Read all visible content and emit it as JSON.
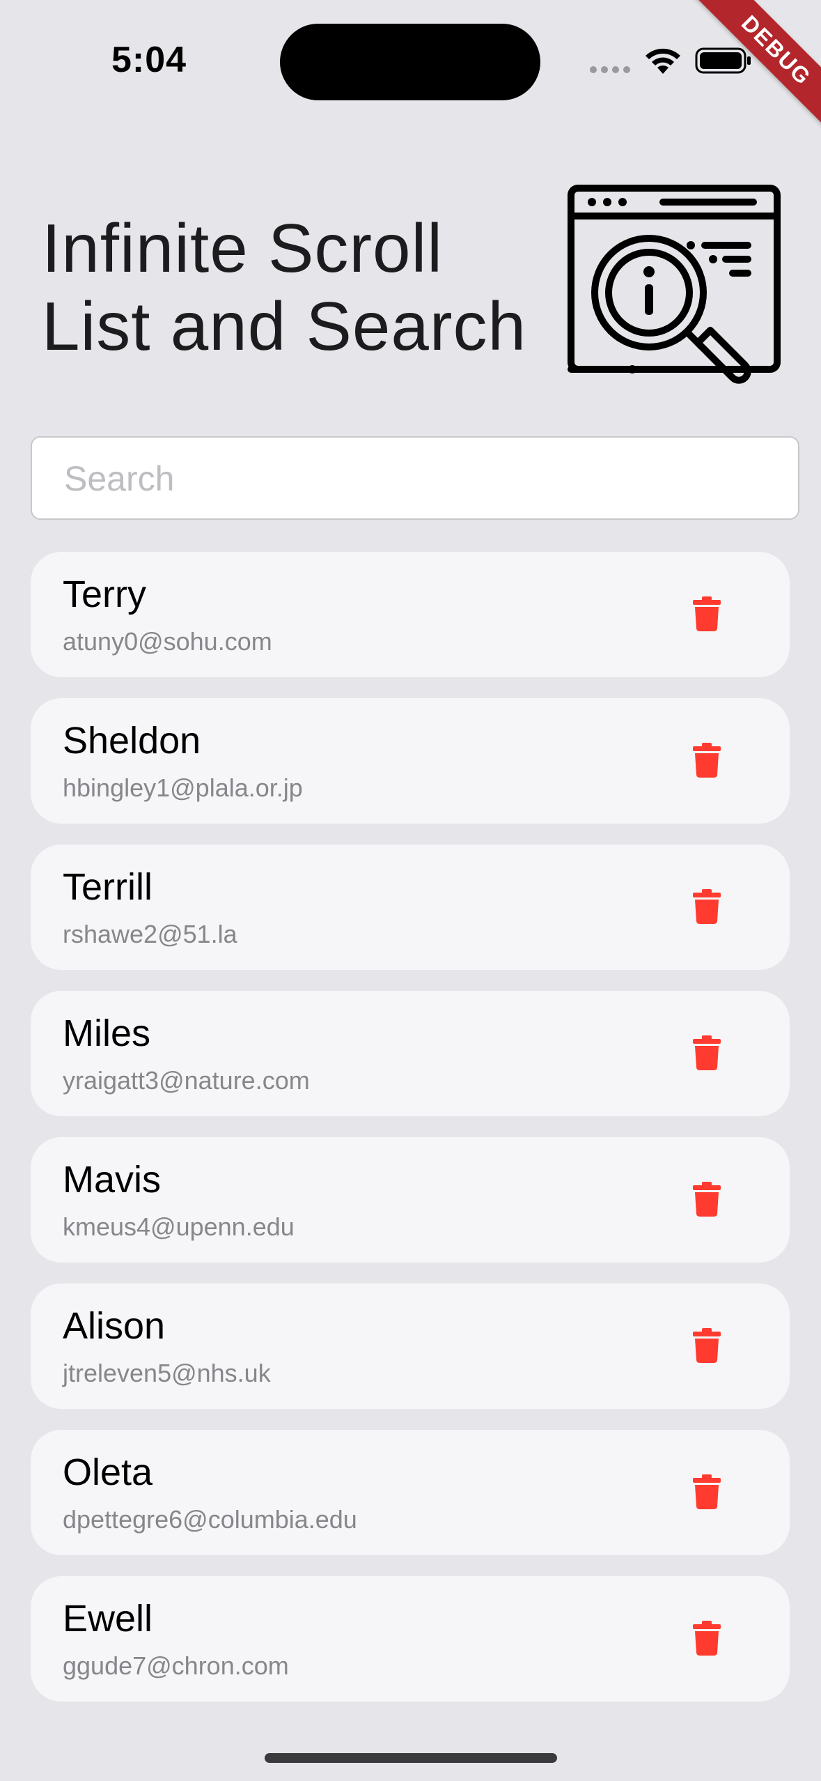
{
  "status_bar": {
    "time": "5:04",
    "debug_label": "DEBUG"
  },
  "header": {
    "title_line1": "Infinite Scroll",
    "title_line2": "List and Search",
    "illustration_icon": "browser-magnifier-info-icon"
  },
  "search": {
    "placeholder": "Search",
    "value": ""
  },
  "colors": {
    "background": "#e6e6ea",
    "card": "#f6f6f8",
    "delete": "#ff3b30",
    "debug_banner": "#b3272c"
  },
  "contacts": [
    {
      "name": "Terry",
      "email": "atuny0@sohu.com"
    },
    {
      "name": "Sheldon",
      "email": "hbingley1@plala.or.jp"
    },
    {
      "name": "Terrill",
      "email": "rshawe2@51.la"
    },
    {
      "name": "Miles",
      "email": "yraigatt3@nature.com"
    },
    {
      "name": "Mavis",
      "email": "kmeus4@upenn.edu"
    },
    {
      "name": "Alison",
      "email": "jtreleven5@nhs.uk"
    },
    {
      "name": "Oleta",
      "email": "dpettegre6@columbia.edu"
    },
    {
      "name": "Ewell",
      "email": "ggude7@chron.com"
    }
  ],
  "item_action_icon": "trash-icon"
}
